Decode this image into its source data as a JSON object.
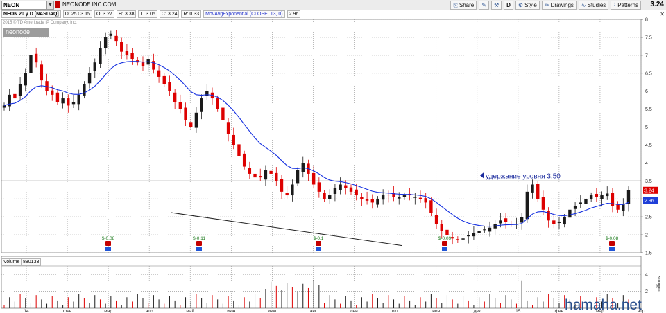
{
  "toolbar": {
    "symbol": "NEON",
    "company_name": "NEONODE INC COM",
    "buttons": [
      {
        "label": "Share",
        "icon": "share-icon"
      },
      {
        "label": "",
        "icon": "edit-icon"
      },
      {
        "label": "",
        "icon": "tools-icon"
      },
      {
        "label": "D",
        "icon": ""
      },
      {
        "label": "Style",
        "icon": "gear-icon"
      },
      {
        "label": "Drawings",
        "icon": "pencil-icon"
      },
      {
        "label": "Studies",
        "icon": "studies-icon"
      },
      {
        "label": "Patterns",
        "icon": "patterns-icon"
      }
    ],
    "last_price": "3.24"
  },
  "info_bar": {
    "title": "NEON 20 y D [NASDAQ]",
    "date": "D: 25.03.15",
    "open": "O: 3.27",
    "high": "H: 3.38",
    "low": "L: 3.05",
    "close": "C: 3.24",
    "range": "R: 0.33",
    "study": "MovAvgExponential (CLOSE, 13, 0)",
    "study_value": "2.96"
  },
  "copyright": "2015 © TD Ameritrade IP Company, Inc.",
  "logo_text": "neonode",
  "price_axis": [
    "8",
    "7.5",
    "7",
    "6.5",
    "6",
    "5.5",
    "5",
    "4.5",
    "4",
    "3.5",
    "3",
    "2.5",
    "2",
    "1.5"
  ],
  "price_badges": {
    "last": "3.24",
    "ema": "2.96"
  },
  "months": [
    "14",
    "фев",
    "мар",
    "апр",
    "май",
    "июн",
    "июл",
    "авг",
    "сен",
    "окт",
    "ноя",
    "дек",
    "15",
    "фев",
    "мар",
    "апр"
  ],
  "dividends": [
    "$-0.08",
    "$-0.11",
    "$-0.1",
    "$-0.09",
    "$-0.08"
  ],
  "annotation": "удержание уровня 3,50",
  "volume": {
    "label": "Volume",
    "value": "880133",
    "axis": [
      "4",
      "2"
    ],
    "axis_unit": "millions"
  },
  "watermark": "hamaha.net",
  "colors": {
    "up": "#1a1a1a",
    "down": "#dd0000",
    "ema": "#1530e0",
    "last_badge": "#dd0000",
    "ema_badge": "#1f3fd8"
  },
  "chart_data": {
    "type": "candlestick",
    "title": "NEON 20 y D [NASDAQ]",
    "ylim": [
      1.5,
      8.0
    ],
    "ema_period": 13,
    "support_level": 3.5,
    "trend_line": {
      "start": {
        "x": "окт",
        "y": 1.7
      },
      "end": {
        "x": "мар",
        "y": 2.62
      }
    },
    "close_series": [
      5.6,
      5.9,
      5.8,
      6.2,
      6.5,
      7.0,
      6.8,
      6.3,
      6.0,
      5.9,
      5.7,
      5.8,
      5.6,
      5.7,
      5.9,
      6.2,
      6.5,
      6.8,
      7.2,
      7.5,
      7.6,
      7.4,
      7.1,
      7.0,
      6.9,
      6.8,
      6.7,
      6.9,
      6.6,
      6.4,
      6.2,
      6.0,
      5.7,
      5.5,
      5.2,
      5.0,
      5.4,
      5.8,
      6.0,
      5.8,
      5.5,
      5.2,
      4.8,
      4.5,
      4.2,
      3.9,
      3.7,
      3.6,
      3.6,
      3.8,
      3.7,
      3.5,
      3.2,
      3.1,
      3.4,
      3.8,
      4.0,
      3.7,
      3.4,
      3.2,
      3.0,
      3.1,
      3.3,
      3.4,
      3.3,
      3.2,
      3.1,
      3.0,
      2.95,
      2.9,
      3.0,
      3.1,
      3.1,
      3.05,
      3.05,
      3.1,
      3.1,
      3.05,
      3.0,
      2.9,
      2.6,
      2.3,
      2.1,
      2.0,
      1.9,
      1.85,
      1.9,
      2.0,
      2.05,
      2.1,
      2.15,
      2.2,
      2.3,
      2.4,
      2.35,
      2.3,
      2.3,
      2.5,
      3.2,
      3.4,
      3.0,
      2.7,
      2.4,
      2.3,
      2.35,
      2.5,
      2.7,
      2.8,
      2.9,
      3.0,
      3.1,
      3.05,
      3.1,
      3.15,
      2.8,
      2.7,
      2.85,
      3.24
    ]
  }
}
